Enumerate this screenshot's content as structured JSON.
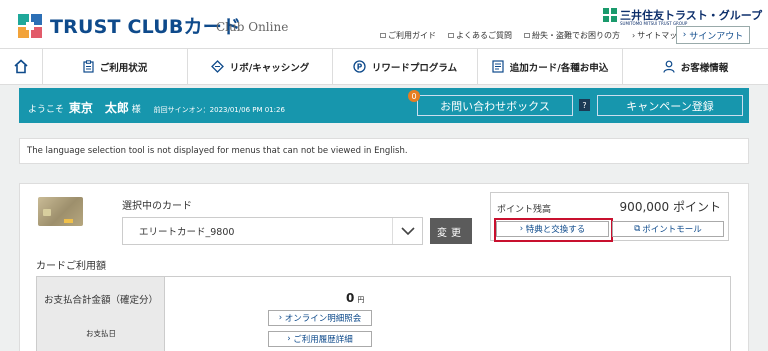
{
  "header": {
    "logo_text": "TRUST CLUBカード",
    "logo_sub": "Club Online",
    "group_logo": "三井住友トラスト・グループ",
    "group_logo_sub": "SUMITOMO MITSUI TRUST GROUP",
    "links": [
      "ご利用ガイド",
      "よくあるご質問",
      "紛失・盗難でお困りの方",
      "サイトマップ"
    ],
    "signout_label": "サインアウト"
  },
  "nav": {
    "home_icon": "home-icon",
    "items": [
      {
        "label": "ご利用状況",
        "icon": "clipboard-icon"
      },
      {
        "label": "リボ/キャッシング",
        "icon": "diamond-icon"
      },
      {
        "label": "リワードプログラム",
        "icon": "p-circle-icon"
      },
      {
        "label": "追加カード/各種お申込",
        "icon": "form-icon"
      },
      {
        "label": "お客様情報",
        "icon": "person-icon"
      }
    ]
  },
  "welcome": {
    "prefix": "ようこそ",
    "name": "東京　太郎",
    "suffix": "様",
    "last_signin": "前回サインオン：2023/01/06 PM 01:26",
    "inquiry_label": "お問い合わせボックス",
    "inquiry_count": "0",
    "help": "?",
    "campaign_label": "キャンペーン登録"
  },
  "notice": "The language selection tool is not displayed for menus that can not be viewed in English.",
  "card_select": {
    "label": "選択中のカード",
    "value": "エリートカード_9800",
    "change_label": "変更"
  },
  "points": {
    "label": "ポイント残高",
    "value": "900,000 ポイント",
    "exchange_label": "特典と交換する",
    "mall_label": "ポイントモール"
  },
  "usage": {
    "title": "カードご利用額",
    "payment_total_label": "お支払合計金額（確定分）",
    "payment_date_label": "お支払日",
    "amount": "0",
    "currency": "円",
    "online_statement_label": "オンライン明細照会",
    "history_label": "ご利用履歴詳細"
  },
  "colors": {
    "brand_blue": "#0e4a8b",
    "teal": "#1796ad",
    "highlight_red": "#c8102e"
  }
}
